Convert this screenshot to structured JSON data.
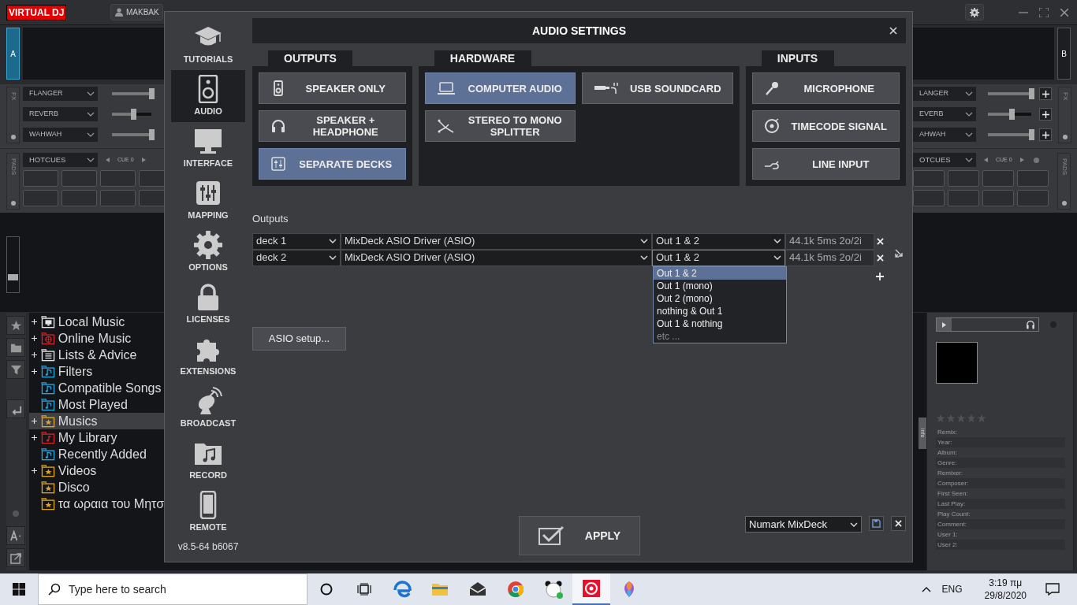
{
  "app": {
    "logo": {
      "left": "VIRTUAL",
      "right": "DJ"
    },
    "user": "MAKBAK"
  },
  "decks": [
    {
      "letter": "A",
      "selected": true
    },
    {
      "letter": "B",
      "selected": false
    }
  ],
  "fx_panels": [
    {
      "label": "FX",
      "add_buttons": false,
      "effects": [
        {
          "name": "FLANGER",
          "level": 1
        },
        {
          "name": "REVERB",
          "level": 0.55
        },
        {
          "name": "WAHWAH",
          "level": 1
        }
      ],
      "pads_label": "PADS",
      "pad_mode": "HOTCUES",
      "cue": "CUE 0"
    },
    {
      "label": "FX",
      "add_buttons": true,
      "effects": [
        {
          "name": "LANGER",
          "level": 1
        },
        {
          "name": "EVERB",
          "level": 0.55
        },
        {
          "name": "AHWAH",
          "level": 1
        }
      ],
      "pads_label": "PADS",
      "pad_mode": "OTCUES",
      "cue": "CUE 0"
    }
  ],
  "pitch_fader": {
    "level": 0.27
  },
  "browser": {
    "items": [
      {
        "label": "Local Music",
        "kind": "computer",
        "expandable": true,
        "selected": false
      },
      {
        "label": "Online Music",
        "kind": "online",
        "expandable": true,
        "selected": false
      },
      {
        "label": "Lists & Advice",
        "kind": "list",
        "expandable": true,
        "selected": false
      },
      {
        "label": "Filters",
        "kind": "filter",
        "expandable": true,
        "selected": false
      },
      {
        "label": "Compatible Songs",
        "kind": "filter",
        "expandable": false,
        "selected": false
      },
      {
        "label": "Most Played",
        "kind": "filter",
        "expandable": false,
        "selected": false
      },
      {
        "label": "Musics",
        "kind": "favorite",
        "expandable": true,
        "selected": true
      },
      {
        "label": "My Library",
        "kind": "library",
        "expandable": true,
        "selected": false
      },
      {
        "label": "Recently Added",
        "kind": "filter",
        "expandable": false,
        "selected": false
      },
      {
        "label": "Videos",
        "kind": "favorite",
        "expandable": true,
        "selected": false
      },
      {
        "label": "Disco",
        "kind": "favorite",
        "expandable": false,
        "selected": false
      },
      {
        "label": "τα ωραια του Μητσ",
        "kind": "favorite",
        "expandable": false,
        "selected": false
      }
    ]
  },
  "info_panel": {
    "tab": "info",
    "stars": 0,
    "fields": [
      "Remix:",
      "Year:",
      "Album:",
      "Genre:",
      "Remixer:",
      "Composer:",
      "First Seen:",
      "Last Play:",
      "Play Count:",
      "Comment:",
      "User 1:",
      "User 2:"
    ]
  },
  "dialog": {
    "title": "AUDIO SETTINGS",
    "sidebar": [
      {
        "label": "TUTORIALS",
        "selected": false
      },
      {
        "label": "AUDIO",
        "selected": true
      },
      {
        "label": "INTERFACE",
        "selected": false
      },
      {
        "label": "MAPPING",
        "selected": false
      },
      {
        "label": "OPTIONS",
        "selected": false
      },
      {
        "label": "LICENSES",
        "selected": false
      },
      {
        "label": "EXTENSIONS",
        "selected": false
      },
      {
        "label": "BROADCAST",
        "selected": false
      },
      {
        "label": "RECORD",
        "selected": false
      },
      {
        "label": "REMOTE",
        "selected": false
      }
    ],
    "version": "v8.5-64 b6067",
    "groups": [
      {
        "title": "OUTPUTS",
        "options": [
          {
            "label": "SPEAKER ONLY",
            "selected": false
          },
          {
            "label": "SPEAKER + HEADPHONE",
            "selected": false
          },
          {
            "label": "SEPARATE DECKS",
            "selected": true
          }
        ]
      },
      {
        "title": "HARDWARE",
        "options": [
          {
            "label": "COMPUTER AUDIO",
            "selected": true
          },
          {
            "label": "USB SOUNDCARD",
            "selected": false
          },
          {
            "label": "STEREO TO MONO SPLITTER",
            "selected": false
          }
        ]
      },
      {
        "title": "INPUTS",
        "options": [
          {
            "label": "MICROPHONE",
            "selected": false
          },
          {
            "label": "TIMECODE SIGNAL",
            "selected": false
          },
          {
            "label": "LINE INPUT",
            "selected": false
          }
        ]
      }
    ],
    "outputs": {
      "label": "Outputs",
      "rows": [
        {
          "deck": "deck 1",
          "driver": "MixDeck ASIO Driver (ASIO)",
          "channels": "Out 1 & 2",
          "info": "44.1k 5ms 2o/2i",
          "menu_open": false
        },
        {
          "deck": "deck 2",
          "driver": "MixDeck ASIO Driver (ASIO)",
          "channels": "Out 1 & 2",
          "info": "44.1k 5ms 2o/2i",
          "menu_open": true
        }
      ],
      "menu": [
        {
          "label": "Out 1 & 2",
          "selected": true,
          "disabled": false
        },
        {
          "label": "Out 1 (mono)",
          "selected": false,
          "disabled": false
        },
        {
          "label": "Out 2 (mono)",
          "selected": false,
          "disabled": false
        },
        {
          "label": "nothing & Out 1",
          "selected": false,
          "disabled": false
        },
        {
          "label": "Out 1 & nothing",
          "selected": false,
          "disabled": false
        },
        {
          "label": "etc ...",
          "selected": false,
          "disabled": true
        }
      ]
    },
    "asio_button": "ASIO setup...",
    "apply_button": "APPLY",
    "preset": "Numark MixDeck"
  },
  "taskbar": {
    "search_placeholder": "Type here to search",
    "language": "ENG",
    "time": "3:19 πμ",
    "date": "29/8/2020",
    "apps": [
      {
        "selected": false
      },
      {
        "selected": false
      },
      {
        "selected": false
      },
      {
        "selected": false
      },
      {
        "selected": false
      },
      {
        "selected": true
      },
      {
        "selected": false
      }
    ]
  }
}
